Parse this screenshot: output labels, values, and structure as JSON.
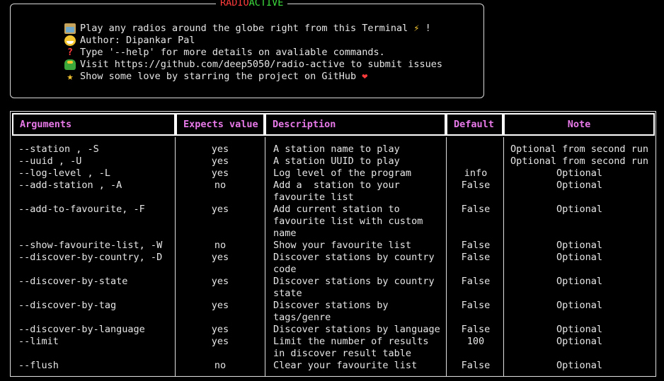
{
  "banner": {
    "title_part1": "RADIO",
    "title_part2": "ACTIVE",
    "lines": [
      {
        "icon": "radio-icon",
        "text": "Play any radios around the globe right from this Terminal ",
        "suffix": "⚡",
        "tail": " !"
      },
      {
        "icon": "grinning-face-icon",
        "text": "Author: Dipankar Pal",
        "suffix": "",
        "tail": ""
      },
      {
        "icon": "question-mark-icon",
        "text": "Type '--help' for more details on avaliable commands.",
        "suffix": "",
        "tail": ""
      },
      {
        "icon": "bug-icon",
        "text": "Visit https://github.com/deep5050/radio-active to submit issues",
        "suffix": "",
        "tail": ""
      },
      {
        "icon": "star-icon",
        "text": "Show some love by starring the project on GitHub ",
        "suffix": "❤",
        "tail": ""
      }
    ]
  },
  "table": {
    "headers": {
      "arguments": "Arguments",
      "expects_value": "Expects value",
      "description": "Description",
      "default": "Default",
      "note": "Note"
    },
    "rows": [
      {
        "arg": "--station , -S",
        "exp": "yes",
        "desc": "A station name to play",
        "def": "",
        "note": "Optional from second run"
      },
      {
        "arg": "--uuid , -U",
        "exp": "yes",
        "desc": "A station UUID to play",
        "def": "",
        "note": "Optional from second run"
      },
      {
        "arg": "--log-level , -L",
        "exp": "yes",
        "desc": "Log level of the program",
        "def": "info",
        "note": "Optional"
      },
      {
        "arg": "--add-station , -A",
        "exp": "no",
        "desc": "Add a  station to your\nfavourite list",
        "def": "False",
        "note": "Optional"
      },
      {
        "arg": "--add-to-favourite, -F",
        "exp": "yes",
        "desc": "Add current station to\nfavourite list with custom\nname",
        "def": "False",
        "note": "Optional"
      },
      {
        "arg": "--show-favourite-list, -W",
        "exp": "no",
        "desc": "Show your favourite list",
        "def": "False",
        "note": "Optional"
      },
      {
        "arg": "--discover-by-country, -D",
        "exp": "yes",
        "desc": "Discover stations by country\ncode",
        "def": "False",
        "note": "Optional"
      },
      {
        "arg": "--discover-by-state",
        "exp": "yes",
        "desc": "Discover stations by country\nstate",
        "def": "False",
        "note": "Optional"
      },
      {
        "arg": "--discover-by-tag",
        "exp": "yes",
        "desc": "Discover stations by\ntags/genre",
        "def": "False",
        "note": "Optional"
      },
      {
        "arg": "--discover-by-language",
        "exp": "yes",
        "desc": "Discover stations by language",
        "def": "False",
        "note": "Optional"
      },
      {
        "arg": "--limit",
        "exp": "yes",
        "desc": "Limit the number of results\nin discover result table",
        "def": "100",
        "note": "Optional"
      },
      {
        "arg": "--flush",
        "exp": "no",
        "desc": "Clear your favourite list",
        "def": "False",
        "note": "Optional"
      }
    ]
  },
  "colors": {
    "background": "#000000",
    "text": "#e6e6e6",
    "header_text": "#e879e8",
    "title_red": "#ff3b3b",
    "title_green": "#3ddc3d"
  }
}
